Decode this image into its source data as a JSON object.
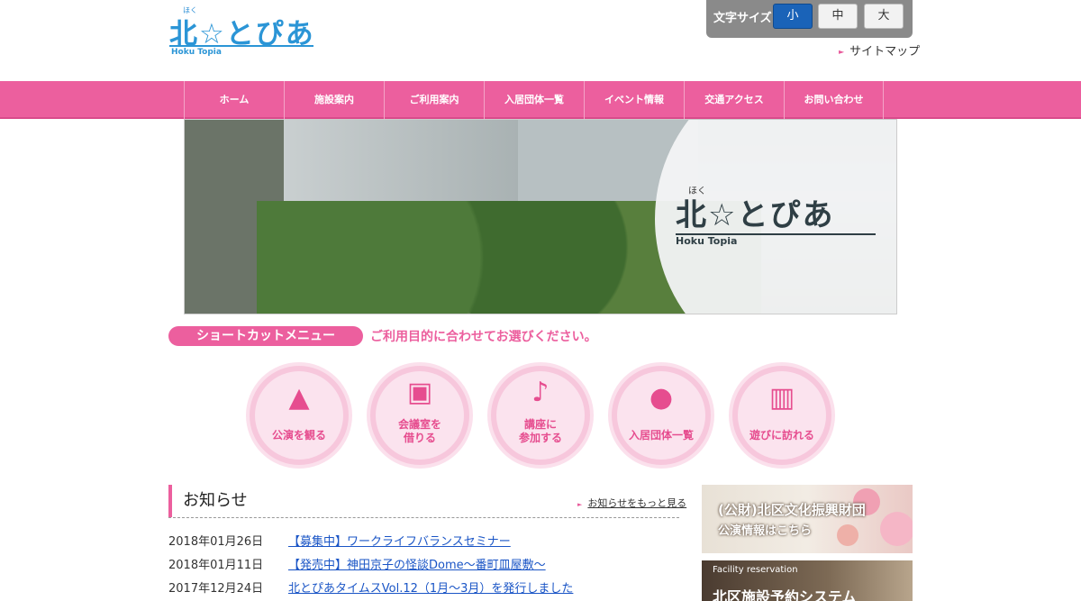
{
  "header": {
    "logo": {
      "ruby": "ほく",
      "title": "北☆とぴあ",
      "subtitle": "Hoku Topia"
    },
    "font_size": {
      "label": "文字サイズ",
      "small": "小",
      "medium": "中",
      "large": "大",
      "selected": "小"
    },
    "sitemap": {
      "arrow": "►",
      "label": "サイトマップ"
    }
  },
  "nav": {
    "items": [
      "ホーム",
      "施設案内",
      "ご利用案内",
      "入居団体一覧",
      "イベント情報",
      "交通アクセス",
      "お問い合わせ"
    ]
  },
  "hero": {
    "logo": {
      "ruby": "ほく",
      "title": "北☆とぴあ",
      "subtitle": "Hoku Topia"
    }
  },
  "shortcut": {
    "label": "ショートカットメニュー",
    "description": "ご利用目的に合わせてお選びください。",
    "items": [
      {
        "icon": "stage-icon",
        "glyph": "▲",
        "label": "公演を観る"
      },
      {
        "icon": "meeting-room-icon",
        "glyph": "▣",
        "label": "会議室を\n借りる"
      },
      {
        "icon": "dance-icon",
        "glyph": "♪",
        "label": "講座に\n参加する"
      },
      {
        "icon": "person-icon",
        "glyph": "●",
        "label": "入居団体一覧"
      },
      {
        "icon": "building-icon",
        "glyph": "▥",
        "label": "遊びに訪れる"
      }
    ]
  },
  "news": {
    "title": "お知らせ",
    "more_arrow": "►",
    "more_label": "お知らせをもっと見る",
    "items": [
      {
        "date": "2018年01月26日",
        "title": "【募集中】ワークライフバランスセミナー"
      },
      {
        "date": "2018年01月11日",
        "title": "【発売中】神田京子の怪談Dome〜番町皿屋敷〜"
      },
      {
        "date": "2017年12月24日",
        "title": "北とぴあタイムスVol.12（1月〜3月）を発行しました"
      }
    ]
  },
  "banners": {
    "foundation": {
      "line1": "(公財)北区文化振興財団",
      "line2": "公演情報はこちら"
    },
    "reservation": {
      "line1": "Facility reservation",
      "line2": "北区施設予約システム"
    }
  },
  "colors": {
    "accent": "#ec5f9e",
    "logo_blue": "#2b95d6",
    "link": "#1a55c6",
    "font_active": "#1a63b8"
  }
}
